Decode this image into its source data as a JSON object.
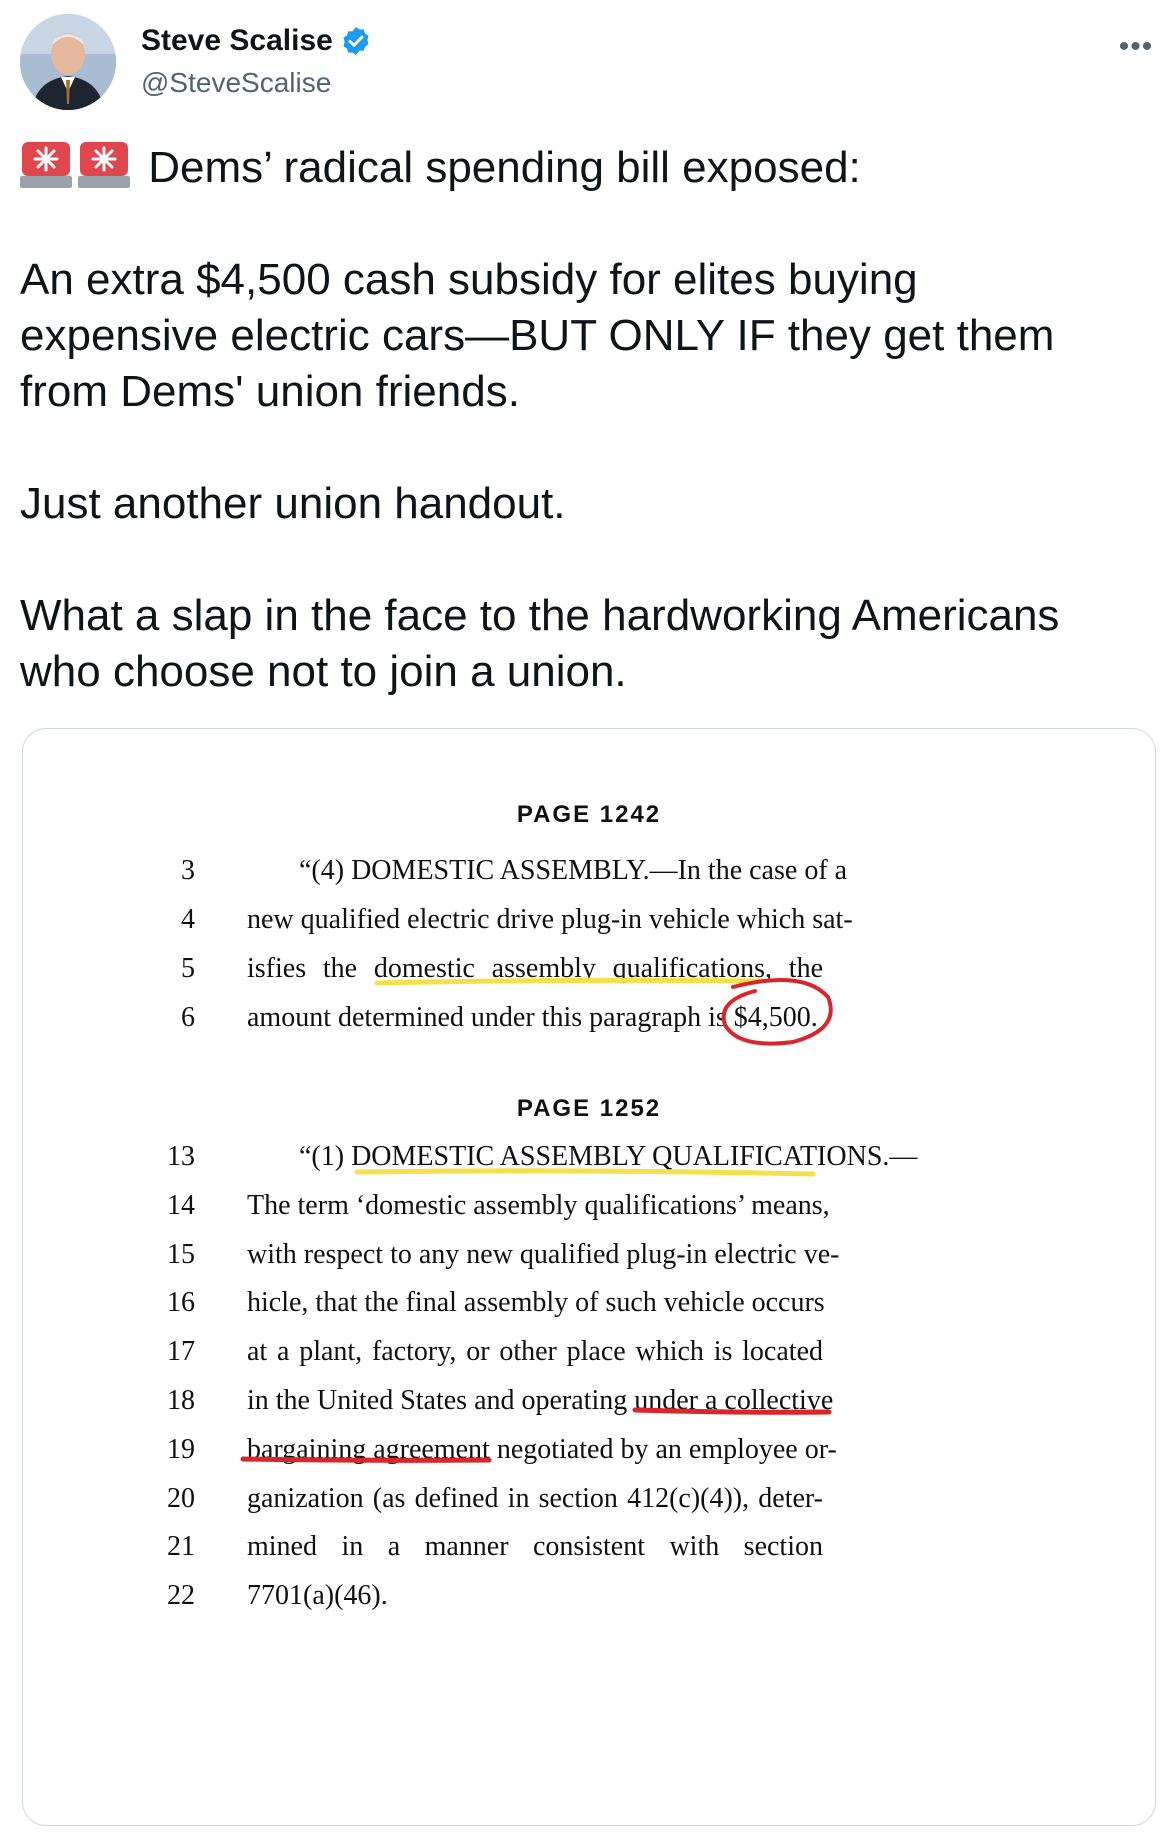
{
  "author": {
    "name": "Steve Scalise",
    "handle": "@SteveScalise",
    "verified": true,
    "more_label": "•••"
  },
  "tweet": {
    "line1": "Dems’ radical spending bill exposed:",
    "para2_line1": "An extra $4,500 cash subsidy for elites buying",
    "para2_line2": "expensive electric cars—BUT ONLY IF they get them",
    "para2_line3": "from Dems' union friends.",
    "para3": "Just another union handout.",
    "para4_line1": "What a slap in the face to the hardworking Americans",
    "para4_line2": "who choose not to join a union."
  },
  "document": {
    "page1_header": "PAGE 1242",
    "page1_lines": [
      {
        "num": "3",
        "text": "“(4) DOMESTIC ASSEMBLY.—In the case of a"
      },
      {
        "num": "4",
        "text": "new qualified electric drive plug-in vehicle which sat-"
      },
      {
        "num": "5",
        "text": "isfies the domestic assembly qualifications, the"
      },
      {
        "num": "6",
        "text": "amount determined under this paragraph is $4,500."
      }
    ],
    "page2_header": "PAGE 1252",
    "page2_lines": [
      {
        "num": "13",
        "text": "“(1) DOMESTIC ASSEMBLY QUALIFICATIONS.—"
      },
      {
        "num": "14",
        "text": "The term ‘domestic assembly qualifications’ means,"
      },
      {
        "num": "15",
        "text": "with respect to any new qualified plug-in electric ve-"
      },
      {
        "num": "16",
        "text": "hicle, that the final assembly of such vehicle occurs"
      },
      {
        "num": "17",
        "text": "at a plant, factory, or other place which is located"
      },
      {
        "num": "18",
        "text": "in the United States and operating under a collective"
      },
      {
        "num": "19",
        "text": "bargaining agreement negotiated by an employee or-"
      },
      {
        "num": "20",
        "text": "ganization (as defined in section 412(c)(4)), deter-"
      },
      {
        "num": "21",
        "text": "mined in a manner consistent with section"
      },
      {
        "num": "22",
        "text": "7701(a)(46)."
      }
    ]
  },
  "colors": {
    "highlight_yellow": "#f5e04a",
    "markup_red": "#d8262b",
    "verified_blue": "#1d9bf0",
    "siren_red": "#e0464e"
  },
  "icons": [
    "siren-emoji-icon",
    "verified-badge-icon",
    "more-options-icon"
  ]
}
